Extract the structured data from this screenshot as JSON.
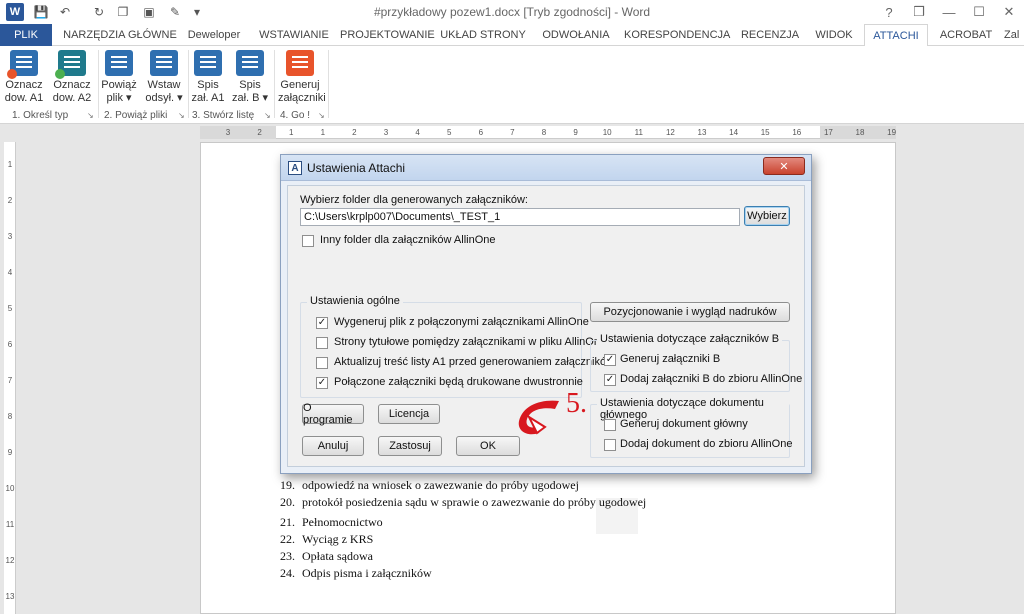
{
  "window": {
    "title": "#przykładowy pozew1.docx [Tryb zgodności] - Word",
    "help": "?",
    "controls": [
      "❒",
      "—",
      "☐",
      "✕"
    ]
  },
  "tabs": [
    "PLIK",
    "NARZĘDZIA GŁÓWNE",
    "Deweloper",
    "WSTAWIANIE",
    "PROJEKTOWANIE",
    "UKŁAD STRONY",
    "ODWOŁANIA",
    "KORESPONDENCJA",
    "RECENZJA",
    "WIDOK",
    "ATTACHI",
    "ACROBAT",
    "Zal"
  ],
  "active_tab": "ATTACHI",
  "ribbon": {
    "buttons": [
      {
        "line1": "Oznacz",
        "line2": "dow. A1",
        "color": "#2f6fb0",
        "badge": "#e8542b"
      },
      {
        "line1": "Oznacz",
        "line2": "dow. A2",
        "color": "#1f7a8c",
        "badge": "#4caf50"
      },
      {
        "line1": "Powiąż",
        "line2": "plik ▾",
        "color": "#2f6fb0",
        "badge": ""
      },
      {
        "line1": "Wstaw",
        "line2": "odsył. ▾",
        "color": "#2f6fb0",
        "badge": ""
      },
      {
        "line1": "Spis",
        "line2": "zał. A1",
        "color": "#2f6fb0",
        "badge": ""
      },
      {
        "line1": "Spis",
        "line2": "zał. B ▾",
        "color": "#2f6fb0",
        "badge": ""
      },
      {
        "line1": "Generuj",
        "line2": "załączniki",
        "color": "#e8542b",
        "badge": ""
      }
    ],
    "groups": [
      "1. Określ typ",
      "2. Powiąż pliki",
      "3. Stwórz listę",
      "4. Go !"
    ]
  },
  "ruler": {
    "ticks": [
      "3",
      "2",
      "1",
      "1",
      "2",
      "3",
      "4",
      "5",
      "6",
      "7",
      "8",
      "9",
      "10",
      "11",
      "12",
      "13",
      "14",
      "15",
      "16",
      "17",
      "18",
      "19"
    ],
    "vticks": [
      "1",
      "2",
      "3",
      "4",
      "5",
      "6",
      "7",
      "8",
      "9",
      "10",
      "11",
      "12",
      "13"
    ]
  },
  "dialog": {
    "title": "Ustawienia Attachi",
    "icon": "A",
    "close": "✕",
    "folder_label": "Wybierz folder dla generowanych załączników:",
    "folder_value": "C:\\Users\\krplp007\\Documents\\_TEST_1",
    "browse": "Wybierz",
    "other_folder": "Inny folder dla załączników AllinOne",
    "general_title": "Ustawienia ogólne",
    "general_options": [
      {
        "label": "Wygeneruj plik z połączonymi załącznikami AllinOne",
        "checked": true
      },
      {
        "label": "Strony tytułowe pomiędzy załącznikami w pliku AllinOne",
        "checked": false
      },
      {
        "label": "Aktualizuj treść listy A1 przed generowaniem załączników",
        "checked": false
      },
      {
        "label": "Połączone załączniki będą drukowane dwustronnie",
        "checked": true
      }
    ],
    "position_btn": "Pozycjonowanie i wygląd nadruków",
    "b_title": "Ustawienia dotyczące załączników B",
    "b_options": [
      {
        "label": "Generuj załączniki B",
        "checked": true
      },
      {
        "label": "Dodaj załączniki B do zbioru AllinOne",
        "checked": true
      }
    ],
    "main_title": "Ustawienia dotyczące dokumentu głównego",
    "main_options": [
      {
        "label": "Generuj dokument główny",
        "checked": false
      },
      {
        "label": "Dodaj dokument do zbioru AllinOne",
        "checked": false
      }
    ],
    "about": "O programie",
    "license": "Licencja",
    "cancel": "Anuluj",
    "apply": "Zastosuj",
    "ok": "OK"
  },
  "annotation": {
    "text": "5.",
    "color": "#d8181f"
  },
  "document": {
    "items": [
      {
        "num": "19.",
        "text": "odpowiedź na wniosek o zawezwanie do próby ugodowej"
      },
      {
        "num": "20.",
        "text": "protokół posiedzenia sądu w sprawie o zawezwanie do próby ugodowej"
      },
      {
        "num": "21.",
        "text": "Pełnomocnictwo"
      },
      {
        "num": "22.",
        "text": "Wyciąg z KRS"
      },
      {
        "num": "23.",
        "text": "Opłata sądowa"
      },
      {
        "num": "24.",
        "text": "Odpis pisma i załączników"
      }
    ]
  }
}
